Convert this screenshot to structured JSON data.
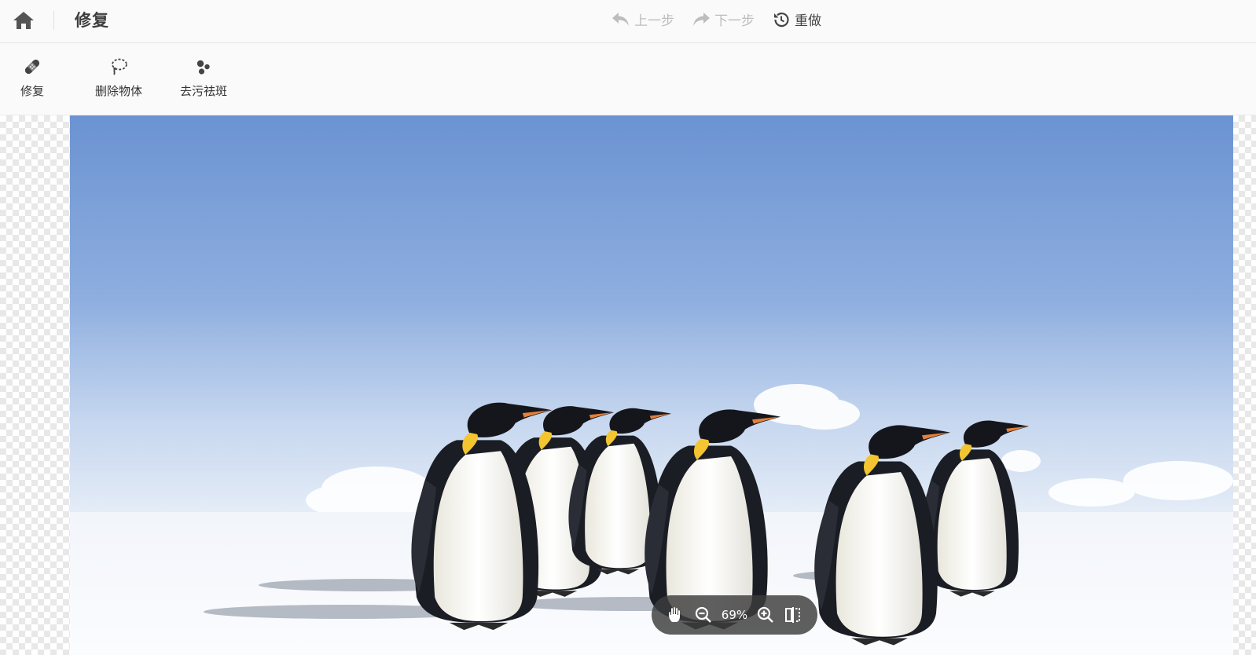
{
  "header": {
    "title": "修复",
    "undo_label": "上一步",
    "redo_label": "下一步",
    "reset_label": "重做"
  },
  "tools": [
    {
      "label": "修复",
      "icon": "bandage-icon"
    },
    {
      "label": "删除物体",
      "icon": "lasso-icon"
    },
    {
      "label": "去污祛斑",
      "icon": "spots-icon"
    }
  ],
  "zoom": {
    "level": "69%",
    "icons": [
      "hand-icon",
      "zoom-out-icon",
      "zoom-in-icon",
      "compare-icon"
    ]
  },
  "colors": {
    "toolbar_bg": "#fafafa",
    "zoom_bg": "#3c3c3c",
    "disabled": "#bdbdbd",
    "sky_top": "#6b93d2"
  }
}
